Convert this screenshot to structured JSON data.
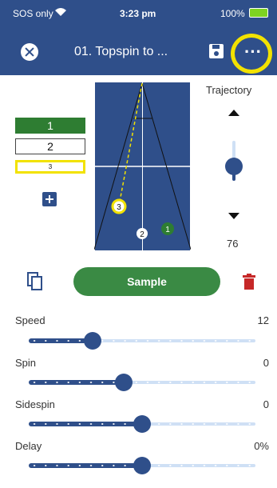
{
  "status_bar": {
    "carrier": "SOS only",
    "time": "3:23 pm",
    "battery": "100%"
  },
  "header": {
    "title": "01. Topspin to ..."
  },
  "slots": {
    "slot1": "1",
    "slot2": "2",
    "slot3": "3"
  },
  "court": {
    "ball_markers": [
      "3",
      "2",
      "1"
    ]
  },
  "trajectory": {
    "label": "Trajectory",
    "value": "76",
    "level": 0.4
  },
  "actions": {
    "sample_label": "Sample"
  },
  "sliders": [
    {
      "label": "Speed",
      "value": "12",
      "position": 0.28
    },
    {
      "label": "Spin",
      "value": "0",
      "position": 0.42
    },
    {
      "label": "Sidespin",
      "value": "0",
      "position": 0.5
    },
    {
      "label": "Delay",
      "value": "0%",
      "position": 0.5
    }
  ],
  "colors": {
    "primary": "#2f4f8a",
    "accent_green": "#2e7d32",
    "sample_green": "#3a8a44",
    "highlight_yellow": "#f2e200",
    "delete_red": "#c62828",
    "track_light": "#cfe0f5"
  }
}
